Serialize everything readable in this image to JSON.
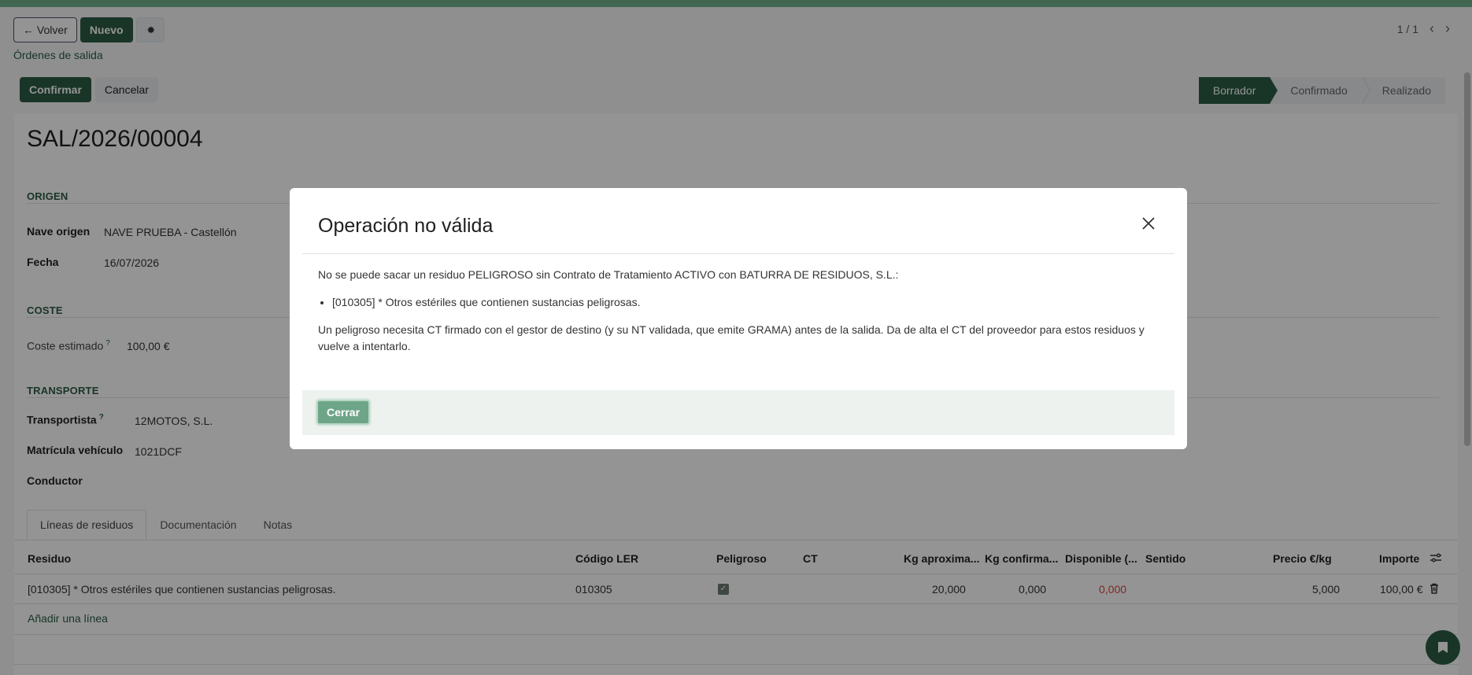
{
  "colors": {
    "accent": "#2c5c44",
    "topbar": "#71b28f",
    "danger": "#d9473b"
  },
  "control_panel": {
    "back_label": "← Volver",
    "new_label": "Nuevo",
    "gear_icon": "gear-icon",
    "breadcrumb": "Órdenes de salida",
    "pager": "1 / 1",
    "prev_icon": "chevron-left-icon",
    "next_icon": "chevron-right-icon",
    "confirm_label": "Confirmar",
    "cancel_label": "Cancelar"
  },
  "statusbar": {
    "steps": [
      "Borrador",
      "Confirmado",
      "Realizado"
    ],
    "active": "Borrador"
  },
  "record": {
    "name": "SAL/2026/00004",
    "origen": {
      "title": "ORIGEN",
      "nave_label": "Nave origen",
      "nave_value": "NAVE PRUEBA - Castellón",
      "fecha_label": "Fecha",
      "fecha_value": "16/07/2026"
    },
    "coste": {
      "title": "COSTE",
      "label": "Coste estimado",
      "help": "?",
      "value": "100,00 €"
    },
    "transporte": {
      "title": "TRANSPORTE",
      "transportista_label": "Transportista",
      "help": "?",
      "transportista_value": "12MOTOS, S.L.",
      "matricula_label": "Matrícula vehículo",
      "matricula_value": "1021DCF",
      "conductor_label": "Conductor"
    }
  },
  "tabs": [
    "Líneas de residuos",
    "Documentación",
    "Notas"
  ],
  "table": {
    "headers": {
      "residuo": "Residuo",
      "ler": "Código LER",
      "peligroso": "Peligroso",
      "ct": "CT",
      "kg_aprox": "Kg aproxima...",
      "kg_conf": "Kg confirma...",
      "disponible": "Disponible (...",
      "sentido": "Sentido",
      "precio": "Precio €/kg",
      "importe": "Importe"
    },
    "rows": [
      {
        "residuo": "[010305] * Otros estériles que contienen sustancias peligrosas.",
        "ler": "010305",
        "peligroso": true,
        "ct": "",
        "kg_aprox": "20,000",
        "kg_conf": "0,000",
        "disponible": "0,000",
        "sentido": "",
        "precio": "5,000",
        "importe": "100,00 €"
      }
    ],
    "add_line": "Añadir una línea"
  },
  "dialog": {
    "title": "Operación no válida",
    "close_icon": "close-icon",
    "message_intro": "No se puede sacar un residuo PELIGROSO sin Contrato de Tratamiento ACTIVO con BATURRA DE RESIDUOS, S.L.:",
    "items": [
      "[010305] * Otros estériles que contienen sustancias peligrosas."
    ],
    "message_outro": "Un peligroso necesita CT firmado con el gestor de destino (y su NT validada, que emite GRAMA) antes de la salida. Da de alta el CT del proveedor para estos residuos y vuelve a intentarlo.",
    "close_label": "Cerrar"
  }
}
